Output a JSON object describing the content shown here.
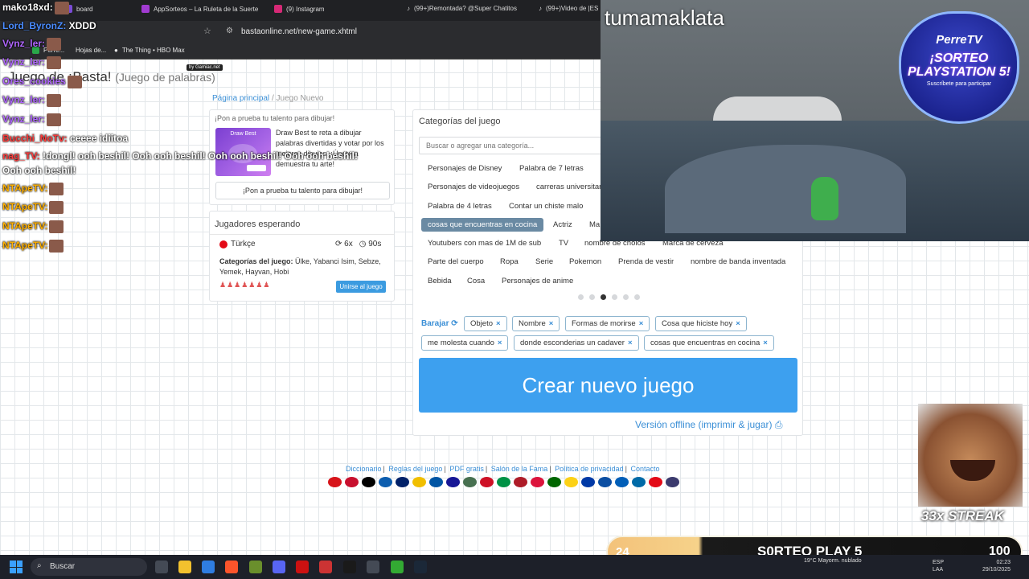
{
  "browser": {
    "tabs": [
      {
        "label": "board",
        "color": "#7a4bd6"
      },
      {
        "label": "AppSorteos – La Ruleta de la Suerte",
        "color": "#a13bd1"
      },
      {
        "label": "(9) Instagram",
        "color": "#d62976"
      },
      {
        "label": "(99+)Remontada? @Super Chatitos",
        "color": "#111111"
      },
      {
        "label": "(99+)Video de |ES",
        "color": "#111111"
      }
    ],
    "url": "bastaonline.net/new-game.xhtml",
    "bookmarks": [
      {
        "label": "Perre...",
        "color": "#2aa84a"
      },
      {
        "label": "Hojas de...",
        "color": "#2aa84a"
      },
      {
        "label": "The Thing • HBO Max",
        "color": "#ffffff"
      }
    ]
  },
  "page": {
    "badge": "by Gamiac.net",
    "title": "Juego de ¡Basta!",
    "title_sub": "(Juego de palabras)",
    "breadcrumb": {
      "home": "Página principal",
      "current": "Juego Nuevo"
    }
  },
  "promo": {
    "header": "¡Pon a prueba tu talento para dibujar!",
    "thumb_title": "Draw Best",
    "text": "Draw Best te reta a dibujar palabras divertidas y votar por los mejores dibujos. ¡Únete a demuestra tu arte!",
    "button": "¡Pon a prueba tu talento para dibujar!"
  },
  "players": {
    "header": "Jugadores esperando",
    "language": "Türkçe",
    "rounds": "6x",
    "time": "90s",
    "categories_label": "Categorías del juego:",
    "categories": "Ülke, Yabanci Isim, Sebze, Yemek, Hayvan, Hobi",
    "player_icons": "♟♟♟♟♟♟♟",
    "join_button": "Unirse al juego"
  },
  "categories": {
    "header": "Categorías del juego",
    "search_placeholder": "Buscar o agregar una categoría...",
    "chips": [
      "Personajes de Disney",
      "Palabra de 7 letras",
      "Personajes de videojuegos",
      "carreras universitarias",
      "Palabra de 4 letras",
      "Contar un chiste malo",
      "cosas que encuentras en cocina",
      "Actriz",
      "Ma",
      "Youtubers con mas de 1M de sub",
      "TV",
      "nombre de cholos",
      "Marca de cerveza",
      "Parte del cuerpo",
      "Ropa",
      "Serie",
      "Pokemon",
      "Prenda de vestir",
      "nombre de banda inventada",
      "Bebida",
      "Cosa",
      "Personajes de anime"
    ],
    "selected_chip": "cosas que encuentras en cocina",
    "carousel_active": 3,
    "shuffle_label": "Barajar",
    "selected": [
      "Objeto",
      "Nombre",
      "Formas de morirse",
      "Cosa que hiciste hoy",
      "me molesta cuando",
      "donde esconderias un cadaver",
      "cosas que encuentras en cocina"
    ],
    "create_button": "Crear nuevo juego",
    "offline_link": "Versión offline (imprimir & jugar)"
  },
  "footer": {
    "links": [
      "Diccionario",
      "Reglas del juego",
      "PDF gratis",
      "Salón de la Fama",
      "Política de privacidad",
      "Contacto"
    ],
    "flags": [
      "#d7141a",
      "#c8102e",
      "#000000",
      "#0d5eaf",
      "#012169",
      "#f1bf00",
      "#0055a4",
      "#171796",
      "#477050",
      "#ce1126",
      "#009246",
      "#ae1c28",
      "#dc143c",
      "#006600",
      "#fcd116",
      "#0039a6",
      "#0b4ea2",
      "#005eb8",
      "#006aa7",
      "#e30a17",
      "#3c3b6e"
    ]
  },
  "stream": {
    "streamer": "tumamaklata",
    "logo_brand": "PerreTV",
    "logo_title": "¡SORTEO PLAYSTATION 5!",
    "logo_sub": "Suscríbete para participar",
    "streak": "33x STREAK",
    "giveaway_count": "24",
    "giveaway_title": "S0RTEO PLAY 5",
    "giveaway_goal": "100",
    "chat": [
      {
        "user": "mako18xd:",
        "msg": "",
        "color": "#ffffff"
      },
      {
        "user": "Lord_ByronZ:",
        "msg": " XDDD",
        "color": "#4a8cff"
      },
      {
        "user": "Vynz_ler:",
        "msg": "",
        "color": "#b066ff"
      },
      {
        "user": "Vynz_ler:",
        "msg": "",
        "color": "#b066ff"
      },
      {
        "user": "Ores_cookies",
        "msg": "",
        "color": "#b066ff"
      },
      {
        "user": "Vynz_ler:",
        "msg": "",
        "color": "#b066ff"
      },
      {
        "user": "Vynz_ler:",
        "msg": "",
        "color": "#b066ff"
      },
      {
        "user": "Bucchi_NoTv:",
        "msg": " ceeee idiitoa",
        "color": "#ff3b3b"
      },
      {
        "user": "nag_TV:",
        "msg": " !dongl! ooh beshil! Ooh ooh beshil! Ooh ooh beshil! Ooh ooh beshil!",
        "color": "#ff3b3b"
      },
      {
        "user": "",
        "msg": "Ooh ooh beshil!",
        "color": "#ffffff"
      },
      {
        "user": "NTApeTV:",
        "msg": "",
        "color": "#ffb000"
      },
      {
        "user": "NTApeTV:",
        "msg": "",
        "color": "#ffb000"
      },
      {
        "user": "NTApeTV:",
        "msg": "",
        "color": "#ffb000"
      },
      {
        "user": "NTApeTV:",
        "msg": "",
        "color": "#ffb000"
      }
    ]
  },
  "taskbar": {
    "search": "Buscar",
    "weather": "19°C Mayorm. nublado",
    "lang_top": "ESP",
    "lang_bottom": "LAA",
    "time": "02:23",
    "date": "29/10/2025",
    "icons": [
      "#444a55",
      "#f2c12e",
      "#2f7de1",
      "#fb542b",
      "#6a8f2c",
      "#5865f2",
      "#cc1111",
      "#cc3333",
      "#1a1a1a",
      "#444a55",
      "#33aa33",
      "#1b2838"
    ]
  }
}
